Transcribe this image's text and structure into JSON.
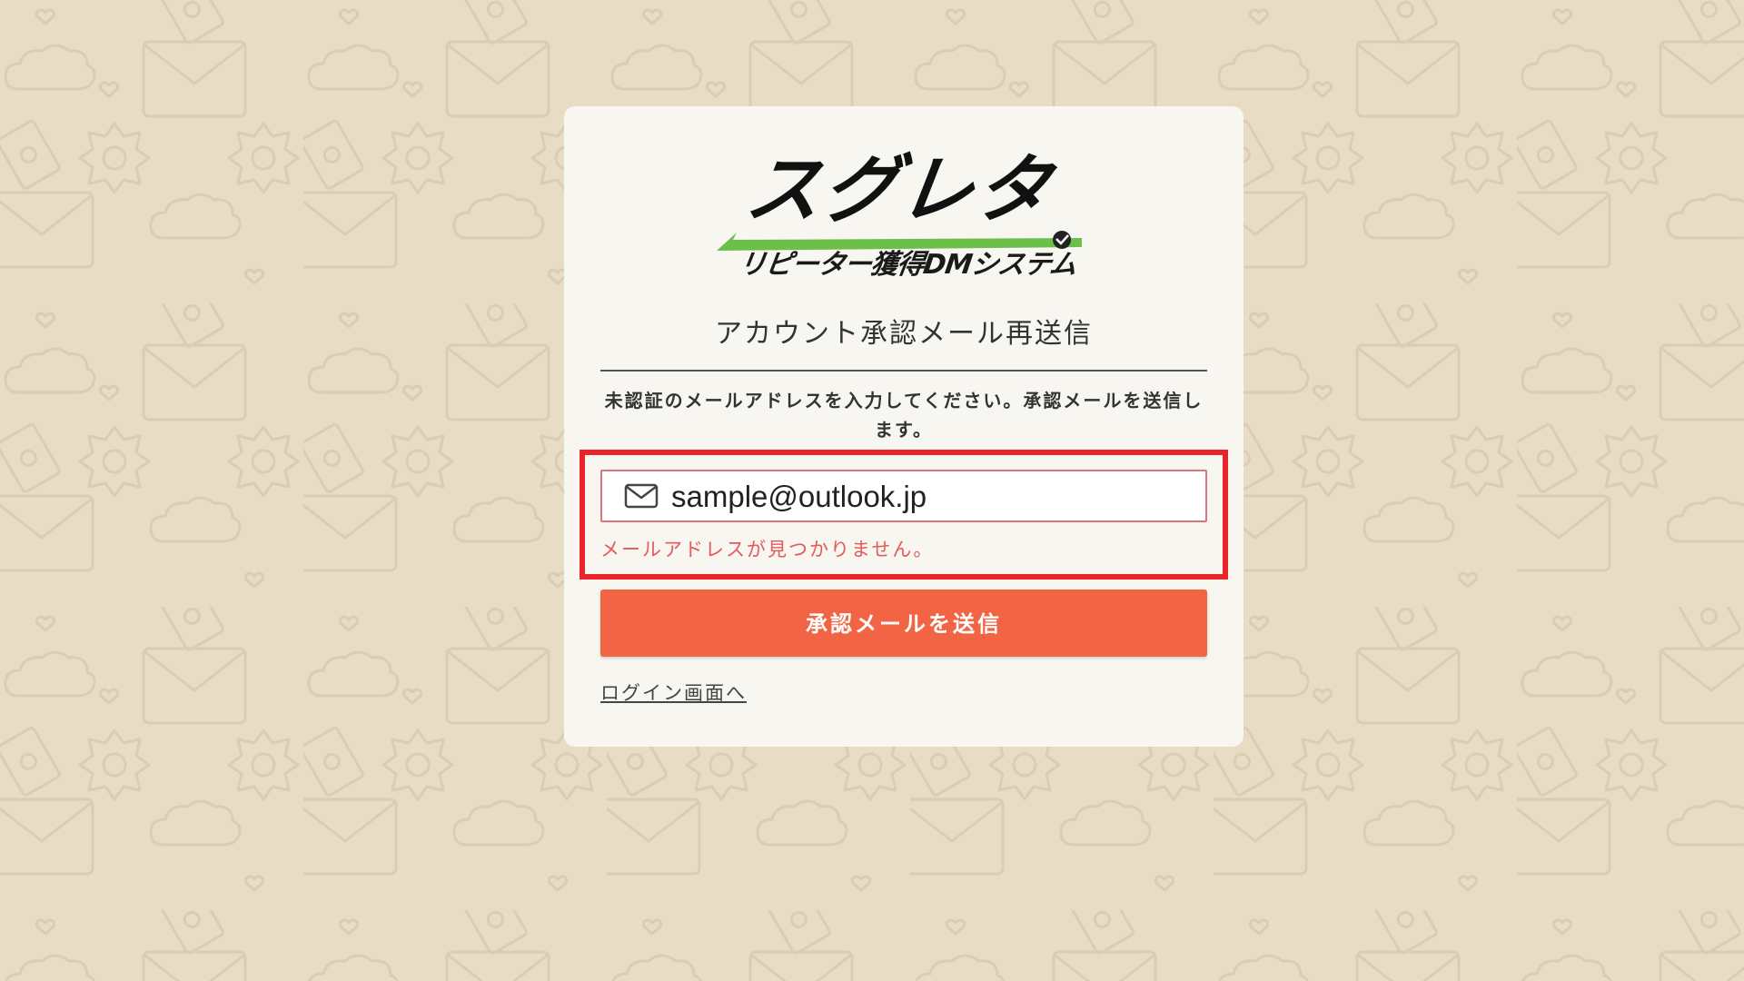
{
  "logo": {
    "main_text": "スグレタ",
    "sub_text": "リピーター獲得DMシステム",
    "accent_color": "#6cc04a"
  },
  "page": {
    "title": "アカウント承認メール再送信",
    "description": "未認証のメールアドレスを入力してください。承認メールを送信します。"
  },
  "form": {
    "email_icon": "mail-icon",
    "email_value": "sample@outlook.jp",
    "error_message": "メールアドレスが見つかりません。",
    "submit_label": "承認メールを送信",
    "submit_color": "#f26544",
    "error_color": "#e45a5a"
  },
  "links": {
    "login": "ログイン画面へ"
  },
  "annotation": {
    "highlight_color": "#e8252a"
  },
  "background": {
    "base_color": "#e8dcc4",
    "pattern_icons": [
      "envelope-icon",
      "cloud-icon",
      "sparkle-icon",
      "card-icon",
      "heart-icon"
    ]
  }
}
